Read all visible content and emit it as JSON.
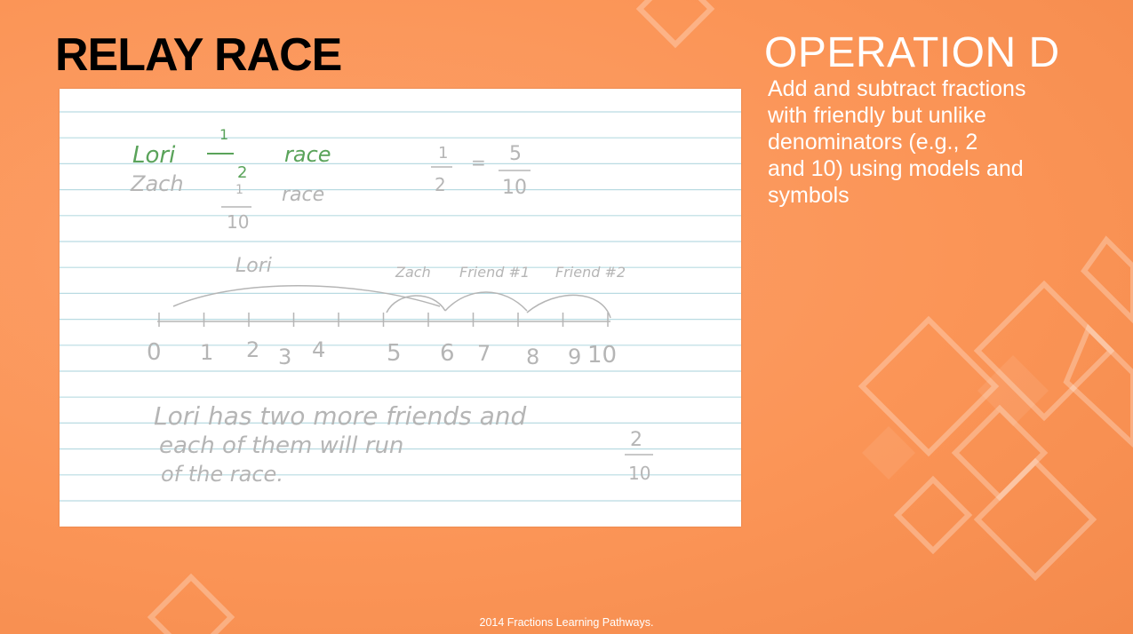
{
  "title": "RELAY RACE",
  "operation": {
    "heading": "OPERATION D",
    "description_lines": [
      "Add and subtract fractions",
      "with friendly but unlike",
      "denominators (e.g., 2",
      "and 10) using models and",
      "symbols"
    ]
  },
  "notecard": {
    "line1": {
      "name": "Lori",
      "num": "1",
      "den": "2",
      "word": "race"
    },
    "line2": {
      "name": "Zach",
      "num": "1",
      "den": "10",
      "word": "race"
    },
    "equation": {
      "left_num": "1",
      "left_den": "2",
      "eq": "=",
      "right_num": "5",
      "right_den": "10"
    },
    "segment_labels": [
      "Lori",
      "Zach",
      "Friend #1",
      "Friend #2"
    ],
    "numbers": [
      "0",
      "1",
      "2",
      "3",
      "4",
      "5",
      "6",
      "7",
      "8",
      "9",
      "10"
    ],
    "sentence_lines": [
      "Lori has two more friends and",
      "each of them will run",
      "of the race."
    ],
    "sentence_fraction": {
      "num": "2",
      "den": "10"
    }
  },
  "colors": {
    "background": "#fb9557",
    "green_ink": "#5aa35a",
    "pencil": "#b5b5b5",
    "rule_line": "#b9dbe2"
  },
  "footer": "2014 Fractions Learning Pathways."
}
